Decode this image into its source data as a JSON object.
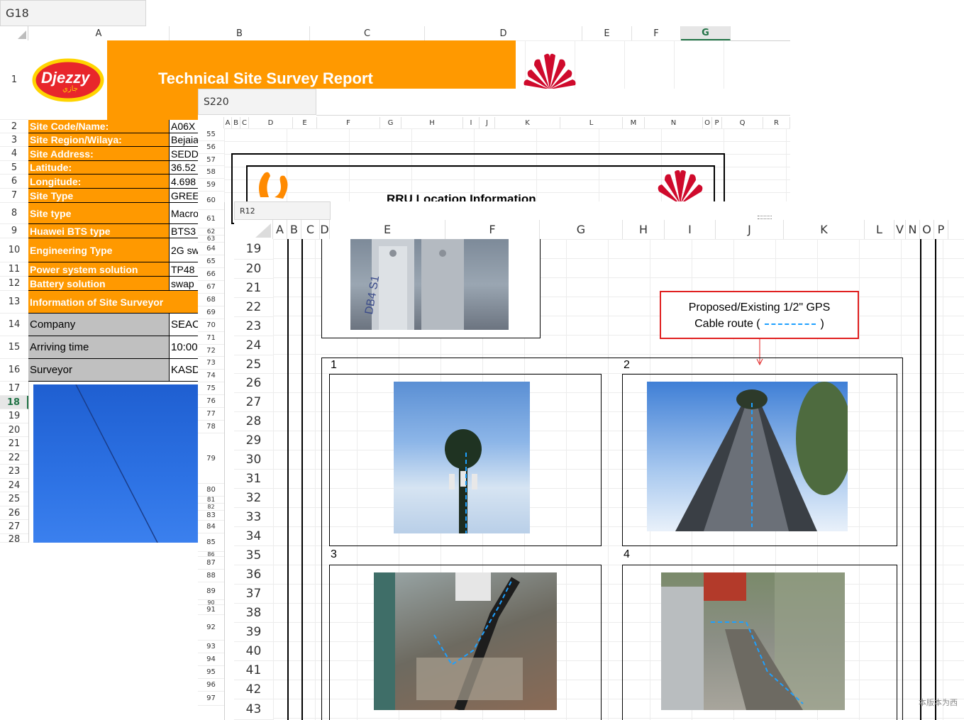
{
  "sheet1": {
    "name_box": "G18",
    "columns": [
      "A",
      "B",
      "C",
      "D",
      "E",
      "F",
      "G"
    ],
    "rows": [
      "1",
      "2",
      "3",
      "4",
      "5",
      "6",
      "7",
      "8",
      "9",
      "10",
      "11",
      "12",
      "13",
      "14",
      "15",
      "16",
      "17",
      "18",
      "19",
      "20",
      "21",
      "22",
      "23",
      "24",
      "25",
      "26",
      "27",
      "28"
    ],
    "title": "Technical Site Survey Report",
    "logo_text": "Djezzy",
    "logo_sub": "جازي",
    "fields": [
      {
        "label": "Site Code/Name:",
        "value": "A06X"
      },
      {
        "label": "Site Region/Wilaya:",
        "value": "Bejaia"
      },
      {
        "label": "Site Address:",
        "value": "SEDD"
      },
      {
        "label": "Latitude:",
        "value": "36.52"
      },
      {
        "label": "Longitude:",
        "value": "4.698"
      },
      {
        "label": "Site Type",
        "value": "GREE"
      },
      {
        "label": "Site type",
        "value": "Macro"
      },
      {
        "label": "Huawei BTS type",
        "value": "BTS3"
      },
      {
        "label": "Engineering Type",
        "value": "2G sw"
      },
      {
        "label": "Power system solution",
        "value": "TP48"
      },
      {
        "label": "Battery solution",
        "value": "swap"
      },
      {
        "label": "Information of Site Surveyor",
        "value": ""
      },
      {
        "label": "Company",
        "value": "SEAC"
      },
      {
        "label": "Arriving time",
        "value": "10:00"
      },
      {
        "label": "Surveyor",
        "value": "KASD"
      }
    ]
  },
  "sheet2": {
    "name_box": "S220",
    "columns": [
      "A",
      "B",
      "C",
      "D",
      "E",
      "F",
      "G",
      "H",
      "I",
      "J",
      "K",
      "L",
      "M",
      "N",
      "O",
      "P",
      "Q",
      "R"
    ],
    "rows": [
      "55",
      "56",
      "57",
      "58",
      "59",
      "60",
      "61",
      "62",
      "63",
      "64",
      "65",
      "66",
      "67",
      "68",
      "69",
      "70",
      "71",
      "72",
      "73",
      "74",
      "75",
      "76",
      "77",
      "78",
      "79",
      "80",
      "81",
      "82",
      "83",
      "84",
      "85",
      "86",
      "87",
      "88",
      "89",
      "90",
      "91",
      "92",
      "93",
      "94",
      "95",
      "96",
      "97"
    ],
    "heading": "RRU Location Information"
  },
  "sheet3": {
    "name_box": "R12",
    "columns": [
      "A",
      "B",
      "C",
      "D",
      "E",
      "F",
      "G",
      "H",
      "I",
      "J",
      "K",
      "L",
      "V",
      "N",
      "O",
      "P"
    ],
    "rows": [
      "19",
      "20",
      "21",
      "22",
      "23",
      "24",
      "25",
      "26",
      "27",
      "28",
      "29",
      "30",
      "31",
      "32",
      "33",
      "34",
      "35",
      "36",
      "37",
      "38",
      "39",
      "40",
      "41",
      "42",
      "43"
    ],
    "photo_numbers": [
      "1",
      "2",
      "3",
      "4"
    ],
    "photo_inner_text": "DB4 S1",
    "callout_line1": "Proposed/Existing 1/2\" GPS",
    "callout_line2a": "Cable route  (",
    "callout_line2b": ")",
    "watermark": "本版本为西"
  },
  "colors": {
    "orange": "#ff9900",
    "huawei_red": "#cf0a2c",
    "callout_border": "#e02020",
    "cable_dash": "#1ea0ff"
  }
}
